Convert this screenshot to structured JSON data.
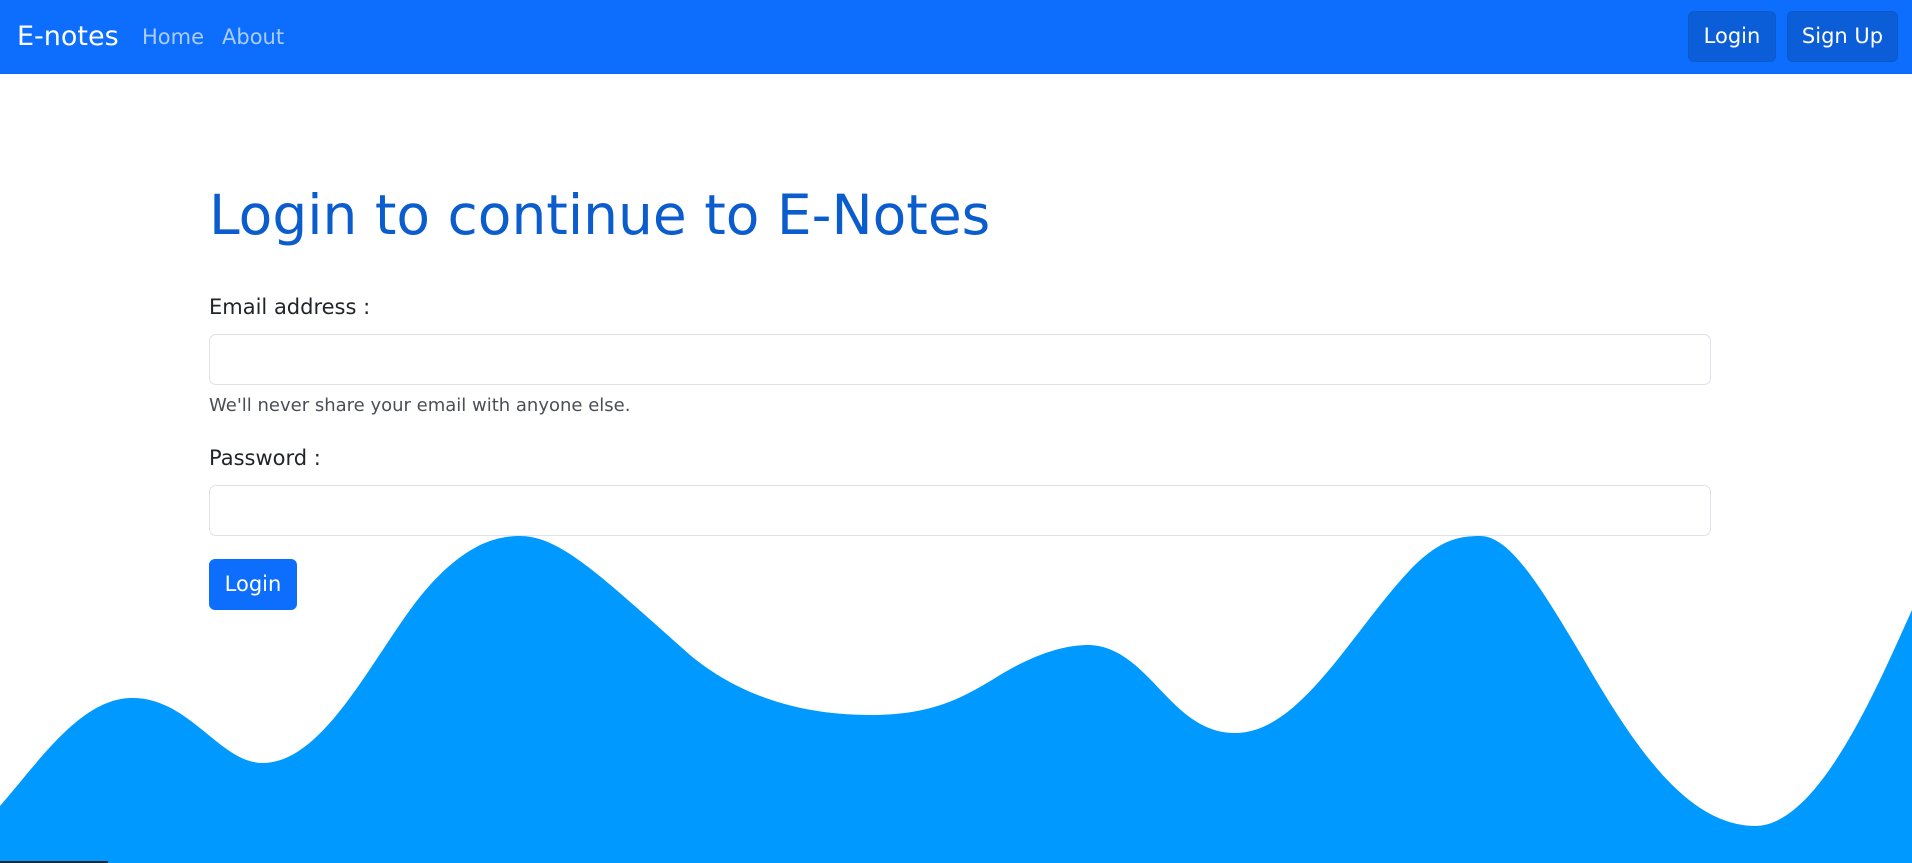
{
  "navbar": {
    "brand": "E-notes",
    "links": [
      {
        "label": "Home"
      },
      {
        "label": "About"
      }
    ],
    "buttons": {
      "login": "Login",
      "signup": "Sign Up"
    }
  },
  "form": {
    "title": "Login to continue to E-Notes",
    "email_label": "Email address :",
    "email_value": "",
    "email_help": "We'll never share your email with anyone else.",
    "password_label": "Password :",
    "password_value": "",
    "submit_label": "Login"
  },
  "colors": {
    "navbar": "#0d6efd",
    "title": "#0b5ccc",
    "wave": "#0099ff"
  }
}
